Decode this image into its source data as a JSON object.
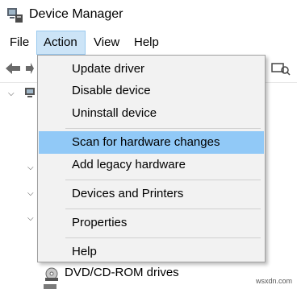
{
  "window": {
    "title": "Device Manager"
  },
  "menubar": {
    "file": "File",
    "action": "Action",
    "view": "View",
    "help": "Help"
  },
  "action_menu": {
    "items": [
      "Update driver",
      "Disable device",
      "Uninstall device",
      "Scan for hardware changes",
      "Add legacy hardware",
      "Devices and Printers",
      "Properties",
      "Help"
    ],
    "highlighted": "Scan for hardware changes"
  },
  "tree": {
    "dvd_label": "DVD/CD-ROM drives"
  },
  "watermark": "wsxdn.com",
  "colors": {
    "highlight": "#91c9f7",
    "menu_active": "#cce4f7",
    "menu_bg": "#f2f2f2"
  }
}
